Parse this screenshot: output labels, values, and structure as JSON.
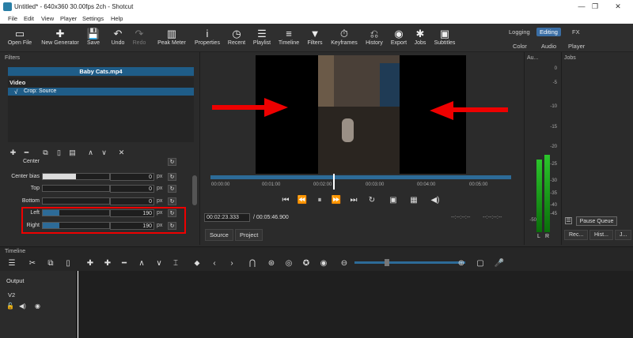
{
  "window": {
    "title": "Untitled* - 640x360 30.00fps 2ch - Shotcut",
    "min": "—",
    "restore": "❐",
    "close": "✕"
  },
  "menu": [
    "File",
    "Edit",
    "View",
    "Player",
    "Settings",
    "Help"
  ],
  "toolbar": [
    {
      "label": "Open File",
      "icon": "▭",
      "name": "open-file"
    },
    {
      "label": "New Generator",
      "icon": "✚",
      "name": "new-generator"
    },
    {
      "label": "Save",
      "icon": "💾",
      "name": "save"
    },
    {
      "label": "Undo",
      "icon": "↶",
      "name": "undo"
    },
    {
      "label": "Redo",
      "icon": "↷",
      "name": "redo",
      "disabled": true
    },
    {
      "label": "Peak Meter",
      "icon": "▥",
      "name": "peak-meter"
    },
    {
      "label": "Properties",
      "icon": "i",
      "name": "properties"
    },
    {
      "label": "Recent",
      "icon": "◷",
      "name": "recent"
    },
    {
      "label": "Playlist",
      "icon": "☰",
      "name": "playlist"
    },
    {
      "label": "Timeline",
      "icon": "≡",
      "name": "timeline"
    },
    {
      "label": "Filters",
      "icon": "▼",
      "name": "filters"
    },
    {
      "label": "Keyframes",
      "icon": "⏱",
      "name": "keyframes"
    },
    {
      "label": "History",
      "icon": "⎌",
      "name": "history"
    },
    {
      "label": "Export",
      "icon": "◉",
      "name": "export"
    },
    {
      "label": "Jobs",
      "icon": "✱",
      "name": "jobs"
    },
    {
      "label": "Subtitles",
      "icon": "▣",
      "name": "subtitles"
    }
  ],
  "layouts": {
    "row1": [
      "Logging",
      "Editing",
      "FX"
    ],
    "row2": [
      "Color",
      "Audio",
      "Player"
    ],
    "active": "Editing"
  },
  "filters": {
    "header": "Filters",
    "file": "Baby Cats.mp4",
    "section": "Video",
    "item": "Crop: Source",
    "check": "√",
    "buttons": [
      "✚",
      "━",
      "⧉",
      "▯",
      "▤",
      "∧",
      "∨",
      "✕"
    ],
    "params": [
      {
        "label": "Center",
        "value": "",
        "unit": "",
        "fill": 0
      },
      {
        "label": "Center bias",
        "value": "0",
        "unit": "px",
        "fill": 0
      },
      {
        "label": "Top",
        "value": "0",
        "unit": "px",
        "fill": 0
      },
      {
        "label": "Bottom",
        "value": "0",
        "unit": "px",
        "fill": 0
      },
      {
        "label": "Left",
        "value": "190",
        "unit": "px",
        "fill": 0.25
      },
      {
        "label": "Right",
        "value": "190",
        "unit": "px",
        "fill": 0.25
      }
    ],
    "reset": "↻"
  },
  "player": {
    "ticks": [
      "00:00:00",
      "00:01:00",
      "00:02:00",
      "00:03:00",
      "00:04:00",
      "00:05:00"
    ],
    "current": "00:02:23.333",
    "duration": "/ 00:05:46.900",
    "in": "--:--:--:--",
    "out": "--:--:--:--",
    "tabs": [
      "Source",
      "Project"
    ],
    "controls": [
      "⏮",
      "⏪",
      "⏸",
      "⏩",
      "⏭",
      "↻",
      "▣",
      "▦",
      "◀)"
    ]
  },
  "audio": {
    "header": "Au...",
    "levels": [
      "0",
      "-5",
      "-10",
      "-15",
      "-20",
      "-25",
      "-30",
      "-35",
      "-40",
      "-45",
      "-50"
    ],
    "channels": [
      "L",
      "R"
    ],
    "left": 0.53,
    "right": 0.57
  },
  "jobs": {
    "header": "Jobs",
    "pause": "Pause Queue",
    "tabs": [
      "Rec...",
      "Hist...",
      "J..."
    ]
  },
  "timeline": {
    "header": "Timeline",
    "output": "Output",
    "track": "V2",
    "tools": [
      "☰",
      "✂",
      "⧉",
      "▯",
      "✚",
      "✚",
      "━",
      "∧",
      "∨",
      "⌶",
      "⬥",
      "‹",
      "›",
      "⋂",
      "⊛",
      "◎",
      "✪",
      "◉",
      "⊖",
      "⊕",
      "▢",
      "🎤"
    ]
  }
}
